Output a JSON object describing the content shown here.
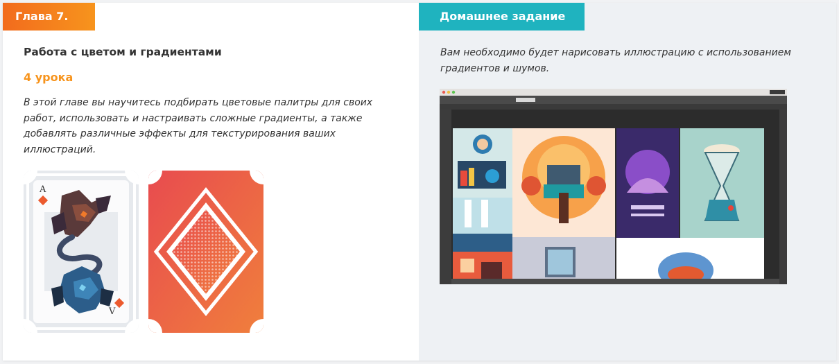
{
  "chapter": {
    "tag": "Глава 7.",
    "title": "Работа с цветом и градиентами",
    "lessons": "4 урока",
    "description": "В этой главе вы научитесь подбирать цветовые палитры для своих работ, использовать и настраивать сложные градиенты, а также добавлять различные эффекты для текстурирования ваших иллюстраций.",
    "cards": [
      {
        "rank_top": "A",
        "rank_bottom": "V"
      },
      {
        "rank_top": "",
        "rank_bottom": ""
      }
    ]
  },
  "homework": {
    "tag": "Домашнее задание",
    "description": "Вам необходимо будет нарисовать иллюстрацию с использованием градиентов и шумов."
  },
  "colors": {
    "chapter_tag": "#f7941d",
    "homework_tag": "#1fb3bf",
    "lessons_text": "#f7941d"
  }
}
